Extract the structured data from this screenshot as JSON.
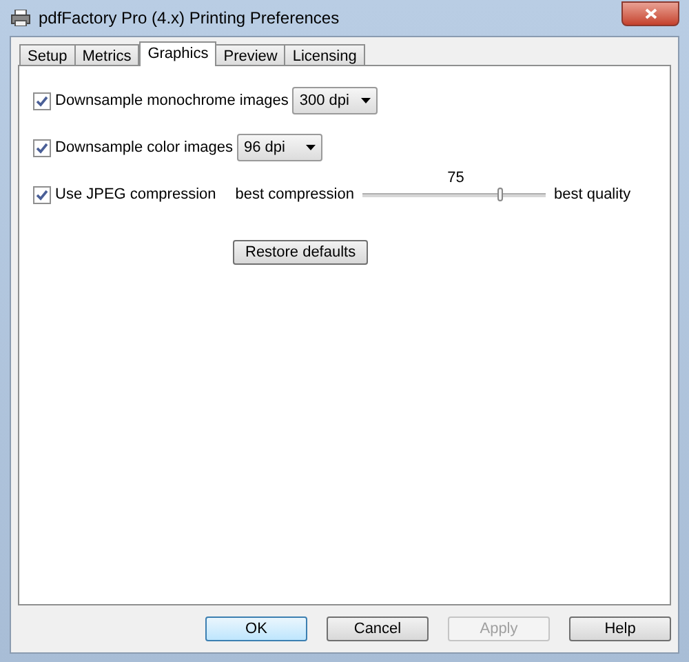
{
  "window": {
    "title": "pdfFactory Pro (4.x) Printing Preferences"
  },
  "tabs": [
    {
      "label": "Setup",
      "selected": false
    },
    {
      "label": "Metrics",
      "selected": false
    },
    {
      "label": "Graphics",
      "selected": true
    },
    {
      "label": "Preview",
      "selected": false
    },
    {
      "label": "Licensing",
      "selected": false
    }
  ],
  "options": [
    {
      "kind": "dropdown",
      "label": "Downsample monochrome images",
      "checked": true,
      "value": "300 dpi"
    },
    {
      "kind": "dropdown",
      "label": "Downsample color images",
      "checked": true,
      "value": "96 dpi"
    },
    {
      "kind": "slider",
      "label": "Use JPEG compression",
      "checked": true,
      "min_label": "best compression",
      "max_label": "best quality",
      "reading": "75",
      "level": 0.75
    }
  ],
  "restore_button": "Restore defaults",
  "buttons": [
    {
      "label": "OK",
      "disabled": false
    },
    {
      "label": "Cancel",
      "disabled": false
    },
    {
      "label": "Apply",
      "disabled": true
    },
    {
      "label": "Help",
      "disabled": false
    }
  ]
}
